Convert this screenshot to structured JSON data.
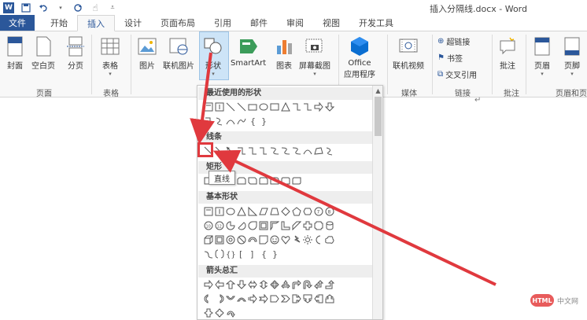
{
  "window": {
    "title": "插入分隔线.docx - Word"
  },
  "quick_access": {
    "icons": [
      "word-logo-icon",
      "save-icon",
      "undo-icon",
      "redo-icon",
      "touch-mode-icon",
      "customize-icon"
    ]
  },
  "tabs": [
    {
      "label": "文件",
      "active": false
    },
    {
      "label": "开始",
      "active": false
    },
    {
      "label": "插入",
      "active": true
    },
    {
      "label": "设计",
      "active": false
    },
    {
      "label": "页面布局",
      "active": false
    },
    {
      "label": "引用",
      "active": false
    },
    {
      "label": "邮件",
      "active": false
    },
    {
      "label": "审阅",
      "active": false
    },
    {
      "label": "视图",
      "active": false
    },
    {
      "label": "开发工具",
      "active": false
    }
  ],
  "ribbon": {
    "buttons": {
      "cover": "封面",
      "blank_page": "空白页",
      "page_break": "分页",
      "table": "表格",
      "picture": "图片",
      "online_picture": "联机图片",
      "shapes": "形状",
      "smartart": "SmartArt",
      "chart": "图表",
      "screenshot": "屏幕截图",
      "office_apps_1": "Office",
      "office_apps_2": "应用程序",
      "online_video": "联机视频",
      "hyperlink": "超链接",
      "bookmark": "书签",
      "cross_reference": "交叉引用",
      "comment": "批注",
      "header": "页眉",
      "footer": "页脚"
    },
    "groups": {
      "pages": "页面",
      "tables": "表格",
      "media": "媒体",
      "links": "链接",
      "comments": "批注",
      "header_footer": "页眉和页"
    }
  },
  "shapes_panel": {
    "sections": {
      "recent": "最近使用的形状",
      "lines": "线条",
      "rectangles": "矩形",
      "basic": "基本形状",
      "arrows": "箭头总汇"
    },
    "tooltip": "直线"
  },
  "colors": {
    "accent": "#2b579a",
    "highlight": "#e0393e",
    "ribbon_bg": "#f8f8f8"
  },
  "watermark": {
    "logo": "HTML",
    "text": "中文网"
  }
}
